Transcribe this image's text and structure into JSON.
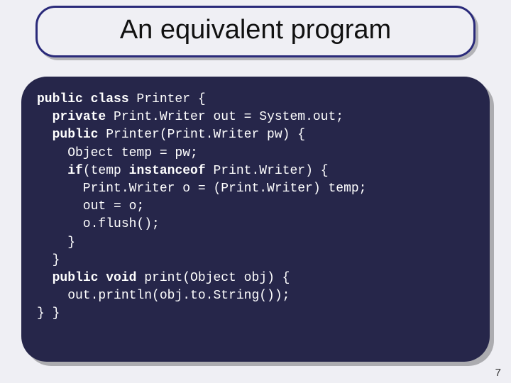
{
  "title": "An equivalent program",
  "code": {
    "l1a": "public class",
    "l1b": " Printer {",
    "l2a": "  ",
    "l2b": "private",
    "l2c": " Print.Writer out = System.out;",
    "l3a": "  ",
    "l3b": "public",
    "l3c": " Printer(Print.Writer pw) {",
    "l4": "    Object temp = pw;",
    "l5a": "    ",
    "l5b": "if",
    "l5c": "(temp ",
    "l5d": "instanceof",
    "l5e": " Print.Writer) {",
    "l6": "      Print.Writer o = (Print.Writer) temp;",
    "l7": "      out = o;",
    "l8": "      o.flush();",
    "l9": "    }",
    "l10": "  }",
    "l11a": "  ",
    "l11b": "public void",
    "l11c": " print(Object obj) {",
    "l12": "    out.println(obj.to.String());",
    "l13": "} }"
  },
  "page_number": "7"
}
